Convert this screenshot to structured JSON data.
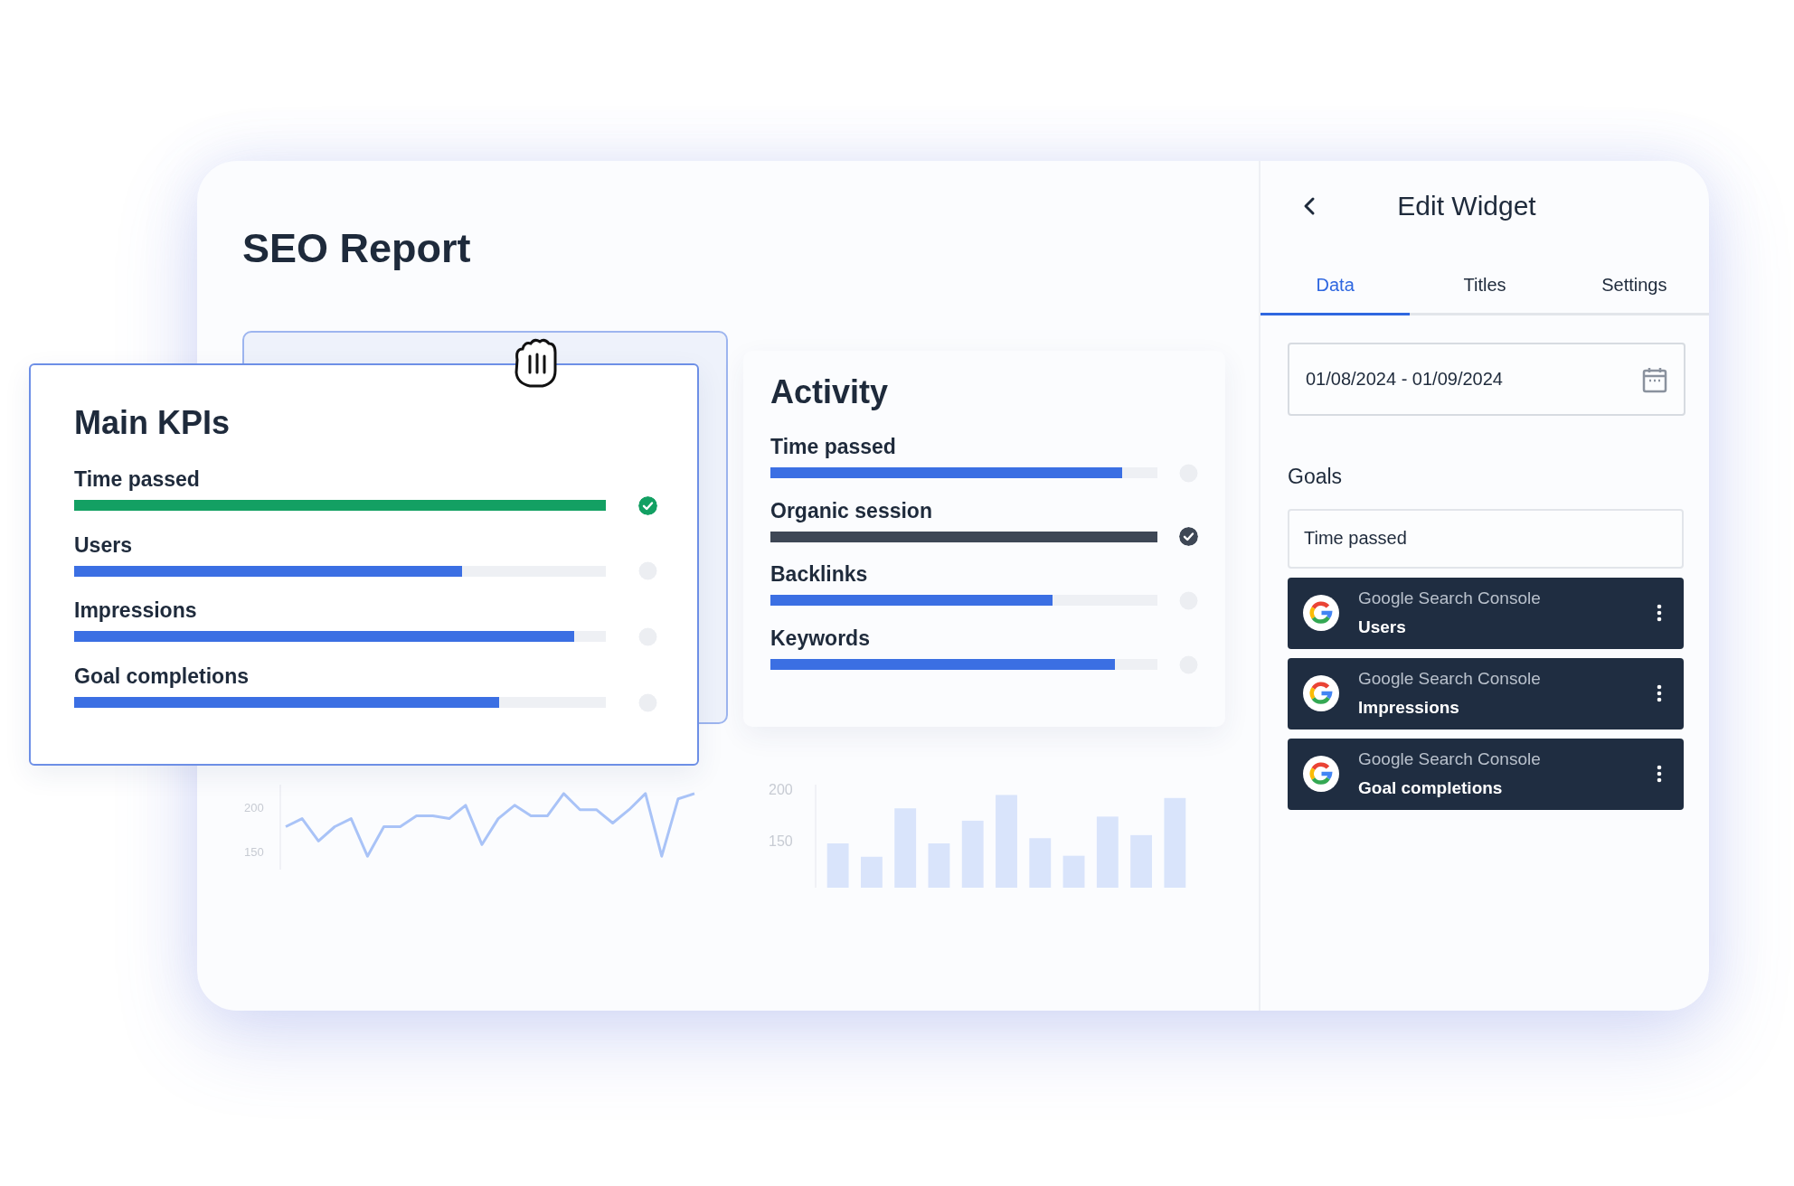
{
  "report": {
    "title": "SEO Report"
  },
  "main_kpis": {
    "title": "Main KPIs",
    "items": [
      {
        "label": "Time passed",
        "level": 1.0,
        "done": true,
        "color": "#13a063"
      },
      {
        "label": "Users",
        "level": 0.73,
        "done": false,
        "color": "#3b6fe3"
      },
      {
        "label": "Impressions",
        "level": 0.94,
        "done": false,
        "color": "#3b6fe3"
      },
      {
        "label": "Goal completions",
        "level": 0.8,
        "done": false,
        "color": "#3b6fe3"
      }
    ]
  },
  "activity": {
    "title": "Activity",
    "items": [
      {
        "label": "Time passed",
        "level": 0.91,
        "done": false,
        "color": "#3b6fe3"
      },
      {
        "label": "Organic session",
        "level": 1.0,
        "done": true,
        "color": "#3e4755"
      },
      {
        "label": "Backlinks",
        "level": 0.73,
        "done": false,
        "color": "#3b6fe3"
      },
      {
        "label": "Keywords",
        "level": 0.89,
        "done": false,
        "color": "#3b6fe3"
      }
    ]
  },
  "line_chart": {
    "chart_data": {
      "type": "line",
      "yticks": [
        150,
        200
      ],
      "ylim": [
        130,
        225
      ],
      "series": [
        {
          "color": "#a9c3f7",
          "values": [
            178,
            187,
            162,
            178,
            187,
            145,
            178,
            178,
            190,
            190,
            187,
            202,
            158,
            187,
            202,
            190,
            190,
            215,
            197,
            197,
            182,
            197,
            215,
            145,
            209,
            215
          ]
        }
      ]
    }
  },
  "bar_chart": {
    "chart_data": {
      "type": "bar",
      "categories": [
        null,
        null,
        null,
        null,
        null,
        null,
        null,
        null,
        null,
        null,
        null
      ],
      "yticks": [
        150,
        200
      ],
      "ylim": [
        105,
        205
      ],
      "series": [
        {
          "color": "#d9e4fb",
          "values": [
            148,
            135,
            182,
            148,
            170,
            195,
            153,
            136,
            174,
            156,
            192
          ]
        }
      ]
    }
  },
  "edit_panel": {
    "title": "Edit Widget",
    "tabs": [
      {
        "label": "Data",
        "selected": true
      },
      {
        "label": "Titles",
        "selected": false
      },
      {
        "label": "Settings",
        "selected": false
      }
    ],
    "date_range": {
      "value": "01/08/2024 - 01/09/2024"
    },
    "goals_label": "Goals",
    "goal_field": {
      "value": "Time passed"
    },
    "sources": [
      {
        "source": "Google Search Console",
        "metric": "Users"
      },
      {
        "source": "Google Search Console",
        "metric": "Impressions"
      },
      {
        "source": "Google Search Console",
        "metric": "Goal completions"
      }
    ]
  }
}
